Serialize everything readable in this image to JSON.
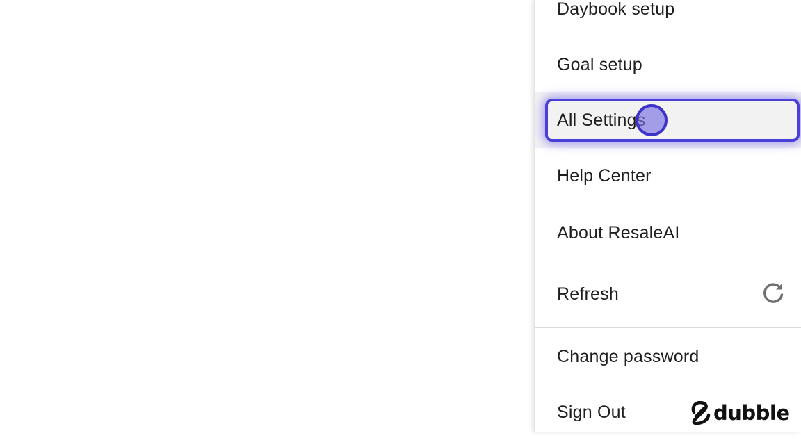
{
  "menu": {
    "items": [
      {
        "label": "Daybook setup"
      },
      {
        "label": "Goal setup"
      },
      {
        "label": "All Settings"
      },
      {
        "label": "Help Center"
      },
      {
        "label": "About ResaleAI"
      },
      {
        "label": "Refresh",
        "icon": "refresh-icon"
      },
      {
        "label": "Change password"
      },
      {
        "label": "Sign Out"
      }
    ],
    "highlighted_item": "All Settings"
  },
  "brand": {
    "name": "dubble",
    "icon": "dubble-logo-icon"
  },
  "colors": {
    "focus_ring": "#4a3fd6",
    "hover_background": "#f2f2f2",
    "divider": "#d9d9d9",
    "text": "#1f1f1f"
  }
}
